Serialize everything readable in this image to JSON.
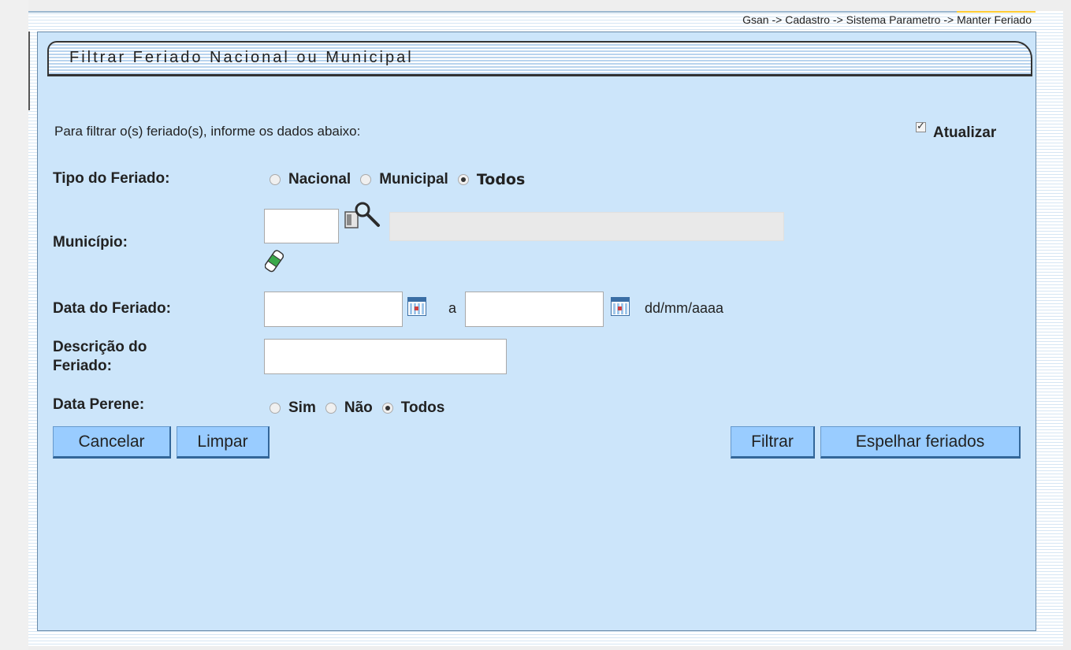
{
  "breadcrumb": "Gsan -> Cadastro -> Sistema Parametro -> Manter Feriado",
  "panel_title": "Filtrar Feriado Nacional ou Municipal",
  "instructions": "Para filtrar o(s) feriado(s), informe os dados abaixo:",
  "atualizar": {
    "label": "Atualizar",
    "checked": true
  },
  "tipo_feriado": {
    "label": "Tipo do Feriado:",
    "options": [
      "Nacional",
      "Municipal",
      "Todos"
    ],
    "selected": "Todos"
  },
  "municipio": {
    "label": "Município:",
    "value": "",
    "name_value": ""
  },
  "data_feriado": {
    "label": "Data do Feriado:",
    "from": "",
    "separator": "a",
    "to": "",
    "format": "dd/mm/aaaa"
  },
  "descricao": {
    "label_line1": "Descrição do",
    "label_line2": "Feriado:",
    "value": ""
  },
  "data_perene": {
    "label": "Data Perene:",
    "options": [
      "Sim",
      "Não",
      "Todos"
    ],
    "selected": "Todos"
  },
  "buttons": {
    "cancelar": "Cancelar",
    "limpar": "Limpar",
    "filtrar": "Filtrar",
    "espelhar": "Espelhar feriados"
  },
  "icons": {
    "search": "magnifier-search-icon",
    "clear": "eraser-icon",
    "calendar": "calendar-icon"
  }
}
